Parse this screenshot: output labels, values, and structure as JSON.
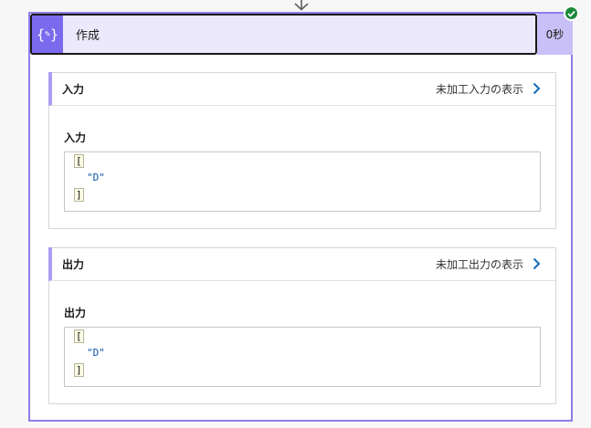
{
  "action": {
    "title": "作成",
    "duration": "0秒",
    "icon": "braces-pen-icon",
    "status": "succeeded"
  },
  "inputs": {
    "section_title": "入力",
    "raw_link_label": "未加工入力の表示",
    "field_label": "入力",
    "json": {
      "open": "[",
      "value": "\"D\"",
      "close": "]"
    }
  },
  "outputs": {
    "section_title": "出力",
    "raw_link_label": "未加工出力の表示",
    "field_label": "出力",
    "json": {
      "open": "[",
      "value": "\"D\"",
      "close": "]"
    }
  },
  "colors": {
    "accent": "#7b69ee",
    "header_bg": "#ece9fd",
    "duration_bg": "#c8c0f6",
    "success": "#1b8a3a",
    "link_chevron": "#0f6cbd"
  }
}
